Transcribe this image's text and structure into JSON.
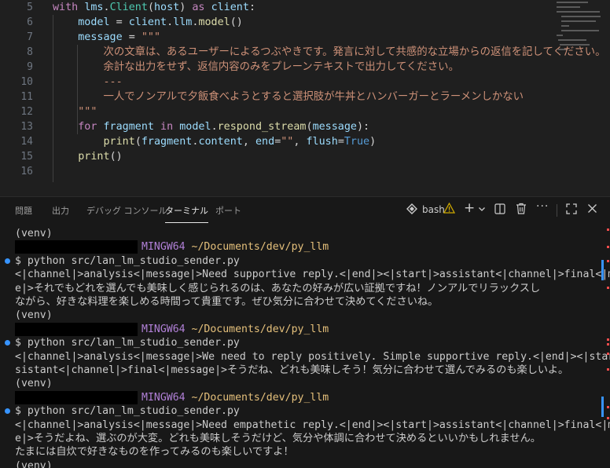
{
  "editor": {
    "lines": [
      {
        "num": "5",
        "tokens": [
          {
            "t": "kw",
            "v": "with "
          },
          {
            "t": "var",
            "v": "lms"
          },
          {
            "t": "op",
            "v": "."
          },
          {
            "t": "cls",
            "v": "Client"
          },
          {
            "t": "op",
            "v": "("
          },
          {
            "t": "var",
            "v": "host"
          },
          {
            "t": "op",
            "v": ") "
          },
          {
            "t": "kw",
            "v": "as "
          },
          {
            "t": "var",
            "v": "client"
          },
          {
            "t": "op",
            "v": ":"
          }
        ]
      },
      {
        "num": "6",
        "tokens": [
          {
            "t": "op",
            "v": "    "
          },
          {
            "t": "var",
            "v": "model"
          },
          {
            "t": "op",
            "v": " = "
          },
          {
            "t": "var",
            "v": "client"
          },
          {
            "t": "op",
            "v": "."
          },
          {
            "t": "var",
            "v": "llm"
          },
          {
            "t": "op",
            "v": "."
          },
          {
            "t": "fn",
            "v": "model"
          },
          {
            "t": "op",
            "v": "()"
          }
        ]
      },
      {
        "num": "7",
        "tokens": [
          {
            "t": "op",
            "v": "    "
          },
          {
            "t": "var",
            "v": "message"
          },
          {
            "t": "op",
            "v": " = "
          },
          {
            "t": "str",
            "v": "\"\"\""
          }
        ]
      },
      {
        "num": "8",
        "tokens": [
          {
            "t": "str",
            "v": "        次の文章は、あるユーザーによるつぶやきです。発言に対して共感的な立場からの返信を記してください。"
          }
        ]
      },
      {
        "num": "9",
        "tokens": [
          {
            "t": "str",
            "v": "        余計な出力をせず、返信内容のみをプレーンテキストで出力してください。"
          }
        ]
      },
      {
        "num": "10",
        "tokens": [
          {
            "t": "str",
            "v": "        ---"
          }
        ]
      },
      {
        "num": "11",
        "tokens": [
          {
            "t": "str",
            "v": "        一人でノンアルで夕飯食べようとすると選択肢が牛丼とハンバーガーとラーメンしかない"
          }
        ]
      },
      {
        "num": "12",
        "tokens": [
          {
            "t": "str",
            "v": "    \"\"\""
          }
        ]
      },
      {
        "num": "13",
        "tokens": [
          {
            "t": "op",
            "v": "    "
          },
          {
            "t": "kw",
            "v": "for "
          },
          {
            "t": "var",
            "v": "fragment"
          },
          {
            "t": "kw",
            "v": " in "
          },
          {
            "t": "var",
            "v": "model"
          },
          {
            "t": "op",
            "v": "."
          },
          {
            "t": "fn",
            "v": "respond_stream"
          },
          {
            "t": "op",
            "v": "("
          },
          {
            "t": "var",
            "v": "message"
          },
          {
            "t": "op",
            "v": "):"
          }
        ]
      },
      {
        "num": "14",
        "tokens": [
          {
            "t": "op",
            "v": "        "
          },
          {
            "t": "fn",
            "v": "print"
          },
          {
            "t": "op",
            "v": "("
          },
          {
            "t": "var",
            "v": "fragment"
          },
          {
            "t": "op",
            "v": "."
          },
          {
            "t": "var",
            "v": "content"
          },
          {
            "t": "op",
            "v": ", "
          },
          {
            "t": "var",
            "v": "end"
          },
          {
            "t": "op",
            "v": "="
          },
          {
            "t": "str",
            "v": "\"\""
          },
          {
            "t": "op",
            "v": ", "
          },
          {
            "t": "var",
            "v": "flush"
          },
          {
            "t": "op",
            "v": "="
          },
          {
            "t": "kw2",
            "v": "True"
          },
          {
            "t": "op",
            "v": ")"
          }
        ]
      },
      {
        "num": "15",
        "tokens": [
          {
            "t": "op",
            "v": "    "
          },
          {
            "t": "fn",
            "v": "print"
          },
          {
            "t": "op",
            "v": "()"
          }
        ]
      },
      {
        "num": "16",
        "tokens": []
      }
    ]
  },
  "panel": {
    "tabs": [
      "問題",
      "出力",
      "デバッグ コンソール",
      "ターミナル",
      "ポート"
    ],
    "active_tab": "ターミナル",
    "shell_label": "bash",
    "icons": {
      "shell": "terminal-profile-icon",
      "warning": "warning-icon",
      "add": "plus-icon",
      "dropdown": "chevron-down-icon",
      "split": "split-terminal-icon",
      "trash": "trash-icon",
      "more": "more-icon",
      "maximize": "maximize-panel-icon",
      "close": "close-icon"
    }
  },
  "terminal": {
    "lines": [
      {
        "kind": "text",
        "text": "(venv)"
      },
      {
        "kind": "prompt",
        "host": "MINGW64",
        "path": "~/Documents/dev/py_llm"
      },
      {
        "kind": "cmd",
        "text": "$ python src/lan_lm_studio_sender.py"
      },
      {
        "kind": "text",
        "text": "<|channel|>analysis<|message|>Need supportive reply.<|end|><|start|>assistant<|channel|>final<|messag"
      },
      {
        "kind": "text",
        "text": "e|>それでもどれを選んでも美味しく感じられるのは、あなたの好みが広い証拠ですね！ノンアルでリラックスし"
      },
      {
        "kind": "text",
        "text": "ながら、好きな料理を楽しめる時間って貴重です。ぜひ気分に合わせて決めてくださいね。"
      },
      {
        "kind": "text",
        "text": "(venv)"
      },
      {
        "kind": "prompt",
        "host": "MINGW64",
        "path": "~/Documents/dev/py_llm"
      },
      {
        "kind": "cmd",
        "text": "$ python src/lan_lm_studio_sender.py"
      },
      {
        "kind": "text",
        "text": "<|channel|>analysis<|message|>We need to reply positively. Simple supportive reply.<|end|><|start|>as"
      },
      {
        "kind": "text",
        "text": "sistant<|channel|>final<|message|>そうだね、どれも美味しそう！気分に合わせて選んでみるのも楽しいよ。"
      },
      {
        "kind": "text",
        "text": "(venv)"
      },
      {
        "kind": "prompt",
        "host": "MINGW64",
        "path": "~/Documents/dev/py_llm"
      },
      {
        "kind": "cmd",
        "text": "$ python src/lan_lm_studio_sender.py"
      },
      {
        "kind": "text",
        "text": "<|channel|>analysis<|message|>Need empathetic reply.<|end|><|start|>assistant<|channel|>final<|messag"
      },
      {
        "kind": "text",
        "text": "e|>そうだよね、選ぶのが大変。どれも美味しそうだけど、気分や体調に合わせて決めるといいかもしれません。"
      },
      {
        "kind": "text",
        "text": "たまには自炊で好きなものを作ってみるのも楽しいですよ！"
      },
      {
        "kind": "text",
        "text": "(venv)"
      }
    ]
  },
  "colors": {
    "accent": "#3794ff",
    "error_marker": "#f14c4c",
    "mingw": "#b180d7",
    "path": "#e5c07b"
  }
}
